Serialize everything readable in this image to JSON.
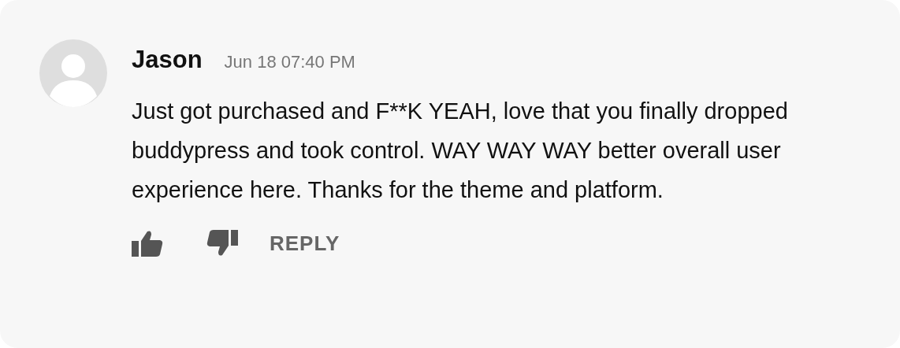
{
  "comment": {
    "author": "Jason",
    "timestamp": "Jun 18 07:40 PM",
    "body": "Just got purchased and F**K YEAH, love that you finally dropped buddypress and took control. WAY WAY WAY better overall user experience here. Thanks for the theme and platform.",
    "reply_label": "REPLY"
  }
}
